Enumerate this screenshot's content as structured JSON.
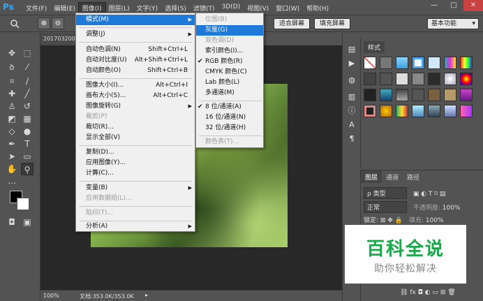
{
  "app": {
    "logo": "Ps"
  },
  "menubar": {
    "items": [
      {
        "label": "文件(F)"
      },
      {
        "label": "编辑(E)"
      },
      {
        "label": "图像(I)"
      },
      {
        "label": "图层(L)"
      },
      {
        "label": "文字(Y)"
      },
      {
        "label": "选择(S)"
      },
      {
        "label": "滤镜(T)"
      },
      {
        "label": "3D(D)"
      },
      {
        "label": "视图(V)"
      },
      {
        "label": "窗口(W)"
      },
      {
        "label": "帮助(H)"
      }
    ],
    "active_index": 2
  },
  "window_controls": {
    "minimize": "—",
    "maximize": "□",
    "close": "✕"
  },
  "options_bar": {
    "fit_screen": "适合屏幕",
    "fill_screen": "填充屏幕",
    "workspace": "基本功能"
  },
  "document": {
    "tab_title": "201703200",
    "zoom": "100%",
    "doc_info": "文档:353.0K/353.0K"
  },
  "image_menu": {
    "items": [
      {
        "label": "模式(M)",
        "shortcut": "",
        "submenu": true,
        "disabled": false,
        "highlighted": true
      },
      {
        "label": "调整(J)",
        "shortcut": "",
        "submenu": true,
        "disabled": false
      },
      {
        "label": "自动色调(N)",
        "shortcut": "Shift+Ctrl+L",
        "disabled": false
      },
      {
        "label": "自动对比度(U)",
        "shortcut": "Alt+Shift+Ctrl+L",
        "disabled": false
      },
      {
        "label": "自动颜色(O)",
        "shortcut": "Shift+Ctrl+B",
        "disabled": false
      },
      {
        "label": "图像大小(I)...",
        "shortcut": "Alt+Ctrl+I",
        "disabled": false
      },
      {
        "label": "画布大小(S)...",
        "shortcut": "Alt+Ctrl+C",
        "disabled": false
      },
      {
        "label": "图像旋转(G)",
        "shortcut": "",
        "submenu": true,
        "disabled": false
      },
      {
        "label": "裁剪(P)",
        "shortcut": "",
        "disabled": true
      },
      {
        "label": "裁切(R)...",
        "shortcut": "",
        "disabled": false
      },
      {
        "label": "显示全部(V)",
        "shortcut": "",
        "disabled": false
      },
      {
        "label": "复制(D)...",
        "shortcut": "",
        "disabled": false
      },
      {
        "label": "应用图像(Y)...",
        "shortcut": "",
        "disabled": false
      },
      {
        "label": "计算(C)...",
        "shortcut": "",
        "disabled": false
      },
      {
        "label": "变量(B)",
        "shortcut": "",
        "submenu": true,
        "disabled": false
      },
      {
        "label": "应用数据组(L)...",
        "shortcut": "",
        "disabled": true
      },
      {
        "label": "陷印(T)...",
        "shortcut": "",
        "disabled": true
      },
      {
        "label": "分析(A)",
        "shortcut": "",
        "submenu": true,
        "disabled": false
      }
    ]
  },
  "mode_submenu": {
    "items": [
      {
        "label": "位图(B)",
        "disabled": true,
        "checked": false
      },
      {
        "label": "灰度(G)",
        "disabled": false,
        "checked": false,
        "highlighted": true
      },
      {
        "label": "双色调(D)",
        "disabled": true,
        "checked": false
      },
      {
        "label": "索引颜色(I)...",
        "disabled": false,
        "checked": false
      },
      {
        "label": "RGB 颜色(R)",
        "disabled": false,
        "checked": true
      },
      {
        "label": "CMYK 颜色(C)",
        "disabled": false,
        "checked": false
      },
      {
        "label": "Lab 颜色(L)",
        "disabled": false,
        "checked": false
      },
      {
        "label": "多通道(M)",
        "disabled": false,
        "checked": false
      },
      {
        "label": "8 位/通道(A)",
        "disabled": false,
        "checked": true
      },
      {
        "label": "16 位/通道(N)",
        "disabled": false,
        "checked": false
      },
      {
        "label": "32 位/通道(H)",
        "disabled": false,
        "checked": false
      },
      {
        "label": "颜色表(T)...",
        "disabled": true,
        "checked": false
      }
    ]
  },
  "swatches_panel": {
    "tab": "样式"
  },
  "layers_panel": {
    "tabs": [
      "图层",
      "通道",
      "路径"
    ],
    "filter_kind": "ρ 类型",
    "blend_mode": "正常",
    "opacity_label": "不透明度:",
    "opacity_value": "100%",
    "lock_label": "锁定:",
    "fill_label": "填充:",
    "fill_value": "100%"
  },
  "watermark": {
    "title": "百科全说",
    "subtitle": "助你轻松解决"
  },
  "colors": {
    "accent": "#1e7ad9",
    "watermark_green": "#17a84a",
    "chrome": "#535353"
  }
}
